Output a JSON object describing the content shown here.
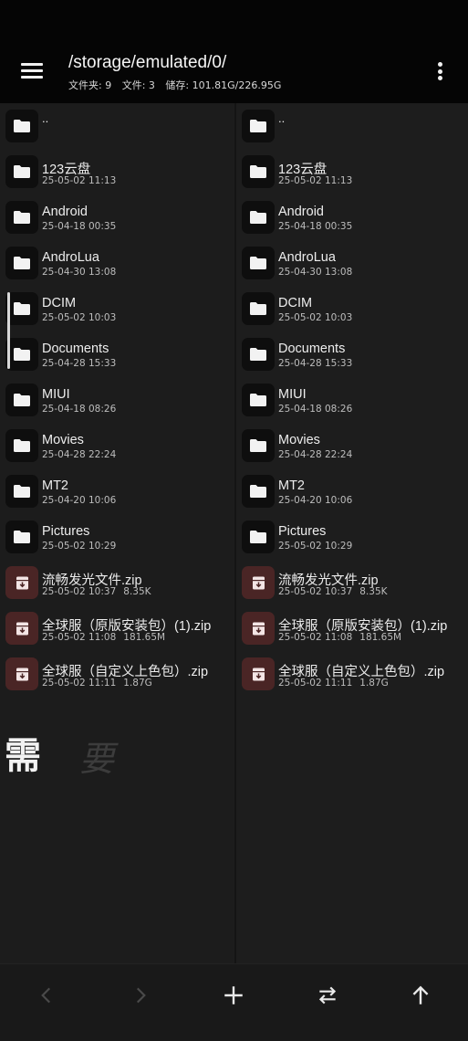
{
  "header": {
    "path": "/storage/emulated/0/",
    "stats": {
      "folders": "文件夹: 9",
      "files": "文件: 3",
      "storage": "储存: 101.81G/226.95G"
    },
    "menu_icon": "hamburger-menu-icon",
    "more_icon": "more-vertical-icon"
  },
  "left_pane": {
    "items": [
      {
        "name": "..",
        "type": "parent"
      },
      {
        "name": "123云盘",
        "date": "25-05-02 11:13",
        "type": "folder"
      },
      {
        "name": "Android",
        "date": "25-04-18 00:35",
        "type": "folder"
      },
      {
        "name": "AndroLua",
        "date": "25-04-30 13:08",
        "type": "folder"
      },
      {
        "name": "DCIM",
        "date": "25-05-02 10:03",
        "type": "folder"
      },
      {
        "name": "Documents",
        "date": "25-04-28 15:33",
        "type": "folder"
      },
      {
        "name": "MIUI",
        "date": "25-04-18 08:26",
        "type": "folder"
      },
      {
        "name": "Movies",
        "date": "25-04-28 22:24",
        "type": "folder"
      },
      {
        "name": "MT2",
        "date": "25-04-20 10:06",
        "type": "folder"
      },
      {
        "name": "Pictures",
        "date": "25-05-02 10:29",
        "type": "folder"
      },
      {
        "name": "流畅发光文件.zip",
        "date": "25-05-02 10:37",
        "size": "8.35K",
        "type": "zip"
      },
      {
        "name": "全球服（原版安装包）(1).zip",
        "date": "25-05-02 11:08",
        "size": "181.65M",
        "type": "zip"
      },
      {
        "name": "全球服（自定义上色包）.zip",
        "date": "25-05-02 11:11",
        "size": "1.87G",
        "type": "zip"
      }
    ]
  },
  "right_pane": {
    "items": [
      {
        "name": "..",
        "type": "parent"
      },
      {
        "name": "123云盘",
        "date": "25-05-02 11:13",
        "type": "folder"
      },
      {
        "name": "Android",
        "date": "25-04-18 00:35",
        "type": "folder"
      },
      {
        "name": "AndroLua",
        "date": "25-04-30 13:08",
        "type": "folder"
      },
      {
        "name": "DCIM",
        "date": "25-05-02 10:03",
        "type": "folder"
      },
      {
        "name": "Documents",
        "date": "25-04-28 15:33",
        "type": "folder"
      },
      {
        "name": "MIUI",
        "date": "25-04-18 08:26",
        "type": "folder"
      },
      {
        "name": "Movies",
        "date": "25-04-28 22:24",
        "type": "folder"
      },
      {
        "name": "MT2",
        "date": "25-04-20 10:06",
        "type": "folder"
      },
      {
        "name": "Pictures",
        "date": "25-05-02 10:29",
        "type": "folder"
      },
      {
        "name": "流畅发光文件.zip",
        "date": "25-05-02 10:37",
        "size": "8.35K",
        "type": "zip"
      },
      {
        "name": "全球服（原版安装包）(1).zip",
        "date": "25-05-02 11:08",
        "size": "181.65M",
        "type": "zip"
      },
      {
        "name": "全球服（自定义上色包）.zip",
        "date": "25-05-02 11:11",
        "size": "1.87G",
        "type": "zip"
      }
    ]
  },
  "overlay": {
    "char1": "需",
    "char2": "要"
  },
  "bottom_bar": {
    "buttons": [
      {
        "name": "back-button",
        "icon": "chevron-left-icon",
        "enabled": false
      },
      {
        "name": "forward-button",
        "icon": "chevron-right-icon",
        "enabled": false
      },
      {
        "name": "add-button",
        "icon": "plus-icon",
        "enabled": true
      },
      {
        "name": "swap-panes-button",
        "icon": "swap-arrows-icon",
        "enabled": true
      },
      {
        "name": "go-up-button",
        "icon": "arrow-up-icon",
        "enabled": true
      }
    ]
  },
  "colors": {
    "header_bg": "#050505",
    "pane_bg": "#1c1c1c",
    "zip_icon_bg": "#4a2525",
    "zip_icon_fg": "#f3e5e5",
    "text": "#ededed",
    "subtext": "#bdbdbd"
  }
}
